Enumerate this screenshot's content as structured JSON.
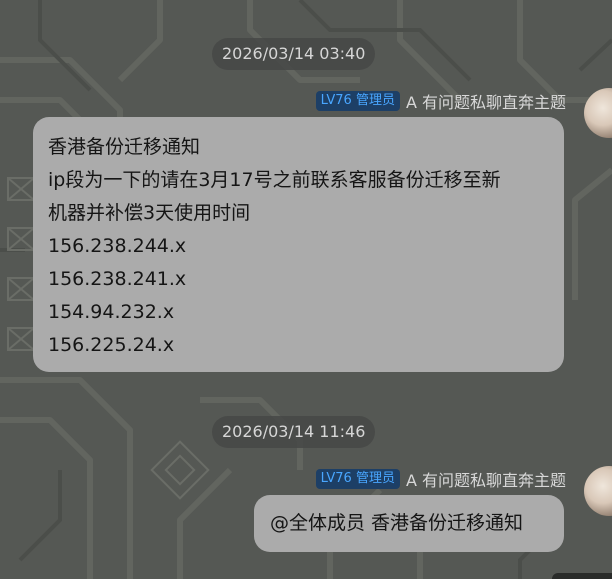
{
  "colors": {
    "background": "#555854",
    "bubble": "#ababab",
    "badge_bg": "#1d3f66",
    "badge_text": "#49a6ff"
  },
  "messages": [
    {
      "timestamp": "2026/03/14 03:40",
      "sender": {
        "level": "LV76 管理员",
        "name": "A 有问题私聊直奔主题"
      },
      "lines": [
        "香港备份迁移通知",
        "ip段为一下的请在3月17号之前联系客服备份迁移至新",
        "机器并补偿3天使用时间",
        "156.238.244.x",
        "156.238.241.x",
        "154.94.232.x",
        "156.225.24.x"
      ]
    },
    {
      "timestamp": "2026/03/14 11:46",
      "sender": {
        "level": "LV76 管理员",
        "name": "A 有问题私聊直奔主题"
      },
      "text": "@全体成员 香港备份迁移通知"
    }
  ]
}
